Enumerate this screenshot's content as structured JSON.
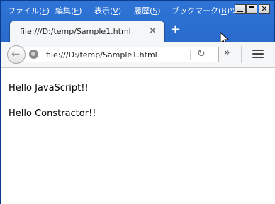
{
  "menubar": {
    "items": [
      {
        "label": "ファイル(",
        "accel": "F",
        "suffix": ")"
      },
      {
        "label": "編集(",
        "accel": "E",
        "suffix": ")"
      },
      {
        "label": "表示(",
        "accel": "V",
        "suffix": ")"
      },
      {
        "label": "履歴(",
        "accel": "S",
        "suffix": ")"
      },
      {
        "label": "ブックマーク(",
        "accel": "B",
        "suffix": ")"
      },
      {
        "label": "ツ",
        "accel": "",
        "suffix": ""
      }
    ]
  },
  "window_buttons": {
    "minimize": "",
    "maximize": "",
    "close": "✕"
  },
  "tab": {
    "title": "file:///D:/temp/Sample1.html",
    "close": "×"
  },
  "newtab": "+",
  "navbar": {
    "back": "←",
    "url": "file:///D:/temp/Sample1.html",
    "reload": "↻",
    "overflow": "»"
  },
  "content": {
    "lines": [
      "Hello JavaScript!!",
      "Hello Constractor!!"
    ]
  }
}
